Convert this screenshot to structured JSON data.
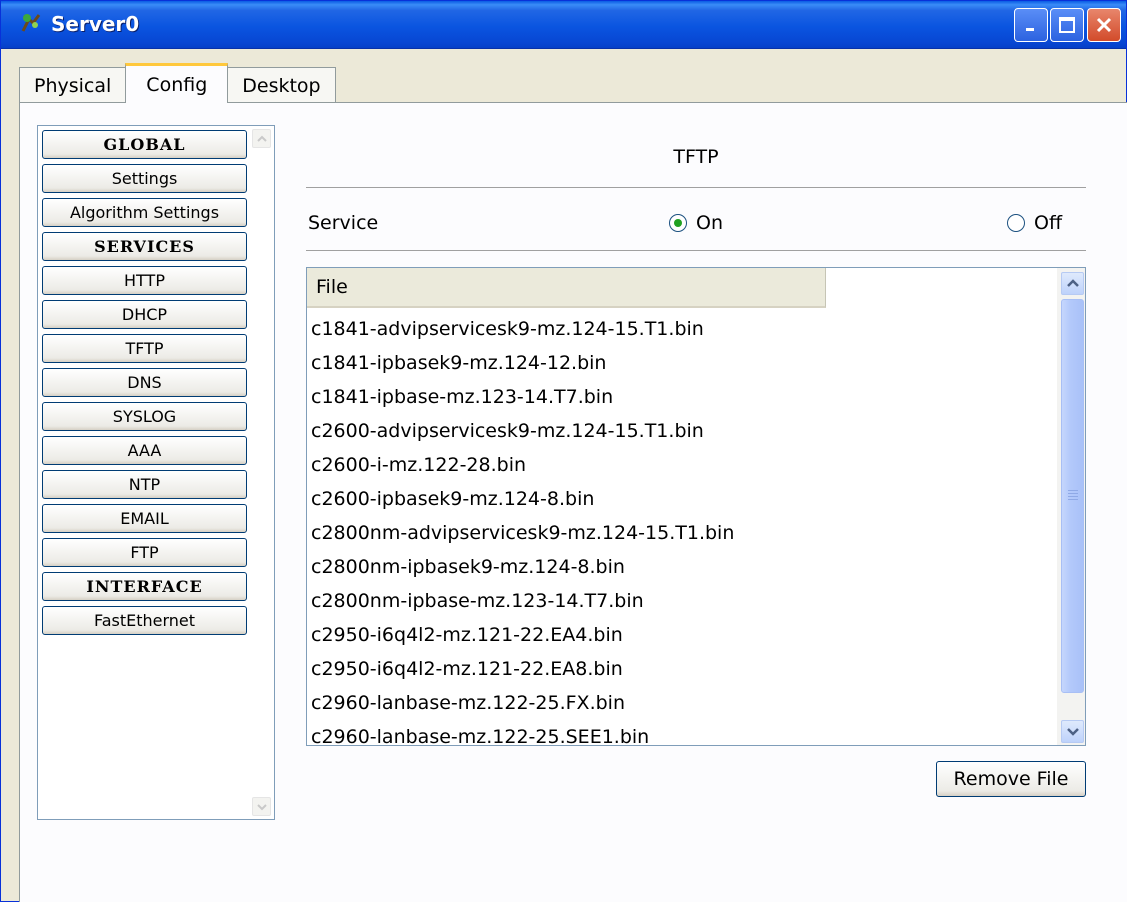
{
  "window": {
    "title": "Server0"
  },
  "tabs": [
    {
      "label": "Physical",
      "active": false
    },
    {
      "label": "Config",
      "active": true
    },
    {
      "label": "Desktop",
      "active": false
    }
  ],
  "nav": {
    "items": [
      {
        "label": "GLOBAL",
        "header": true
      },
      {
        "label": "Settings",
        "header": false
      },
      {
        "label": "Algorithm Settings",
        "header": false
      },
      {
        "label": "SERVICES",
        "header": true
      },
      {
        "label": "HTTP",
        "header": false
      },
      {
        "label": "DHCP",
        "header": false
      },
      {
        "label": "TFTP",
        "header": false
      },
      {
        "label": "DNS",
        "header": false
      },
      {
        "label": "SYSLOG",
        "header": false
      },
      {
        "label": "AAA",
        "header": false
      },
      {
        "label": "NTP",
        "header": false
      },
      {
        "label": "EMAIL",
        "header": false
      },
      {
        "label": "FTP",
        "header": false
      },
      {
        "label": "INTERFACE",
        "header": true
      },
      {
        "label": "FastEthernet",
        "header": false
      }
    ]
  },
  "tftp": {
    "title": "TFTP",
    "service_label": "Service",
    "on_label": "On",
    "off_label": "Off",
    "service_selected": "On",
    "file_column": "File",
    "files": [
      "c1841-advipservicesk9-mz.124-15.T1.bin",
      "c1841-ipbasek9-mz.124-12.bin",
      "c1841-ipbase-mz.123-14.T7.bin",
      "c2600-advipservicesk9-mz.124-15.T1.bin",
      "c2600-i-mz.122-28.bin",
      "c2600-ipbasek9-mz.124-8.bin",
      "c2800nm-advipservicesk9-mz.124-15.T1.bin",
      "c2800nm-ipbasek9-mz.124-8.bin",
      "c2800nm-ipbase-mz.123-14.T7.bin",
      "c2950-i6q4l2-mz.121-22.EA4.bin",
      "c2950-i6q4l2-mz.121-22.EA8.bin",
      "c2960-lanbase-mz.122-25.FX.bin",
      "c2960-lanbase-mz.122-25.SEE1.bin"
    ],
    "remove_label": "Remove File"
  },
  "colors": {
    "titlebar": "#0a55e0",
    "active_tab_accent": "#ffc83c",
    "radio_selected": "#21a121"
  }
}
